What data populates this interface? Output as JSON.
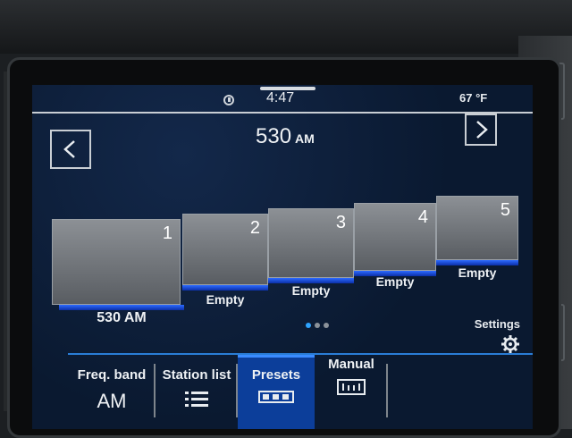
{
  "status": {
    "time": "4:47",
    "temperature": "67 °F",
    "connectivity_icon": "app-connect-icon"
  },
  "header": {
    "frequency": "530",
    "band": "AM",
    "prev_icon": "chevron-left-icon",
    "next_icon": "chevron-right-icon"
  },
  "presets": [
    {
      "number": "1",
      "label": "530 AM"
    },
    {
      "number": "2",
      "label": "Empty"
    },
    {
      "number": "3",
      "label": "Empty"
    },
    {
      "number": "4",
      "label": "Empty"
    },
    {
      "number": "5",
      "label": "Empty"
    }
  ],
  "pagination": {
    "pages": 3,
    "active": 1
  },
  "settings": {
    "label": "Settings",
    "icon": "gear-icon"
  },
  "tabs": {
    "freq_band": {
      "label": "Freq. band",
      "value": "AM"
    },
    "station_list": {
      "label": "Station list",
      "icon": "list-icon"
    },
    "presets": {
      "label": "Presets",
      "icon": "preset-slots-icon"
    },
    "manual": {
      "label": "Manual",
      "icon": "tuning-scale-icon"
    }
  },
  "colors": {
    "screen_background": "#0a1930",
    "accent_blue": "#2d6bff",
    "active_tab": "#0c3e9a"
  }
}
